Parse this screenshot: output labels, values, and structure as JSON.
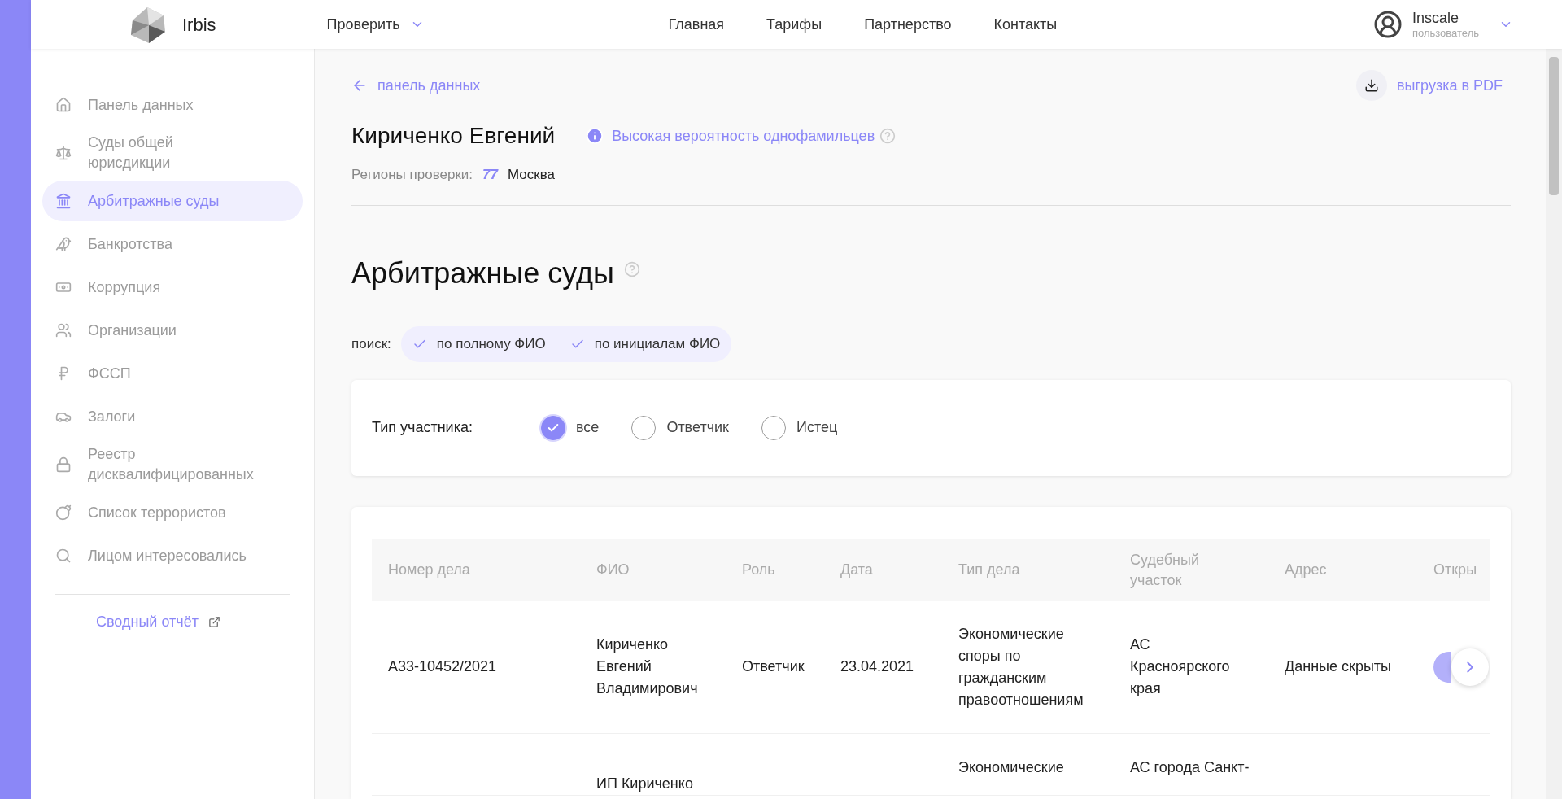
{
  "top_bar": {
    "logo_text": "Irbis",
    "check_menu": "Проверить",
    "nav": [
      "Главная",
      "Тарифы",
      "Партнерство",
      "Контакты"
    ],
    "user": {
      "name": "Inscale",
      "role": "пользователь"
    }
  },
  "sidebar": {
    "items": [
      {
        "label": "Панель данных",
        "selected": false
      },
      {
        "label": "Суды общей юрисдикции",
        "selected": false
      },
      {
        "label": "Арбитражные суды",
        "selected": true
      },
      {
        "label": "Банкротства",
        "selected": false
      },
      {
        "label": "Коррупция",
        "selected": false
      },
      {
        "label": "Организации",
        "selected": false
      },
      {
        "label": "ФССП",
        "selected": false
      },
      {
        "label": "Залоги",
        "selected": false
      },
      {
        "label": "Реестр дисквалифицированных",
        "selected": false
      },
      {
        "label": "Список террористов",
        "selected": false
      },
      {
        "label": "Лицом интересовались",
        "selected": false
      }
    ],
    "summary_link": "Сводный отчёт"
  },
  "back_link": "панель данных",
  "pdf_button": "выгрузка в PDF",
  "person": {
    "name": "Кириченко Евгений",
    "warning": "Высокая вероятность однофамильцев",
    "regions_label": "Регионы проверки:",
    "region_code": "77",
    "region_name": "Москва"
  },
  "section": {
    "title": "Арбитражные суды",
    "search_label": "поиск:",
    "search_options": [
      {
        "label": "по полному ФИО",
        "checked": true
      },
      {
        "label": "по инициалам ФИО",
        "checked": true
      }
    ]
  },
  "filter": {
    "label": "Тип участника:",
    "options": [
      {
        "label": "все",
        "selected": true
      },
      {
        "label": "Ответчик",
        "selected": false
      },
      {
        "label": "Истец",
        "selected": false
      }
    ]
  },
  "table": {
    "columns": [
      "Номер дела",
      "ФИО",
      "Роль",
      "Дата",
      "Тип дела",
      "Судебный участок",
      "Адрес",
      "Откры"
    ],
    "rows": [
      {
        "case_number": "А33-10452/2021",
        "name": "Кириченко Евгений Владимирович",
        "role": "Ответчик",
        "date": "23.04.2021",
        "case_type": "Экономические споры по гражданским правоотношениям",
        "court": "АС Красноярского края",
        "address": "Данные скрыты",
        "has_open_button": true
      },
      {
        "name": "ИП Кириченко",
        "case_type": "Экономические",
        "court": "АС города Санкт-",
        "has_open_button": false
      }
    ]
  }
}
